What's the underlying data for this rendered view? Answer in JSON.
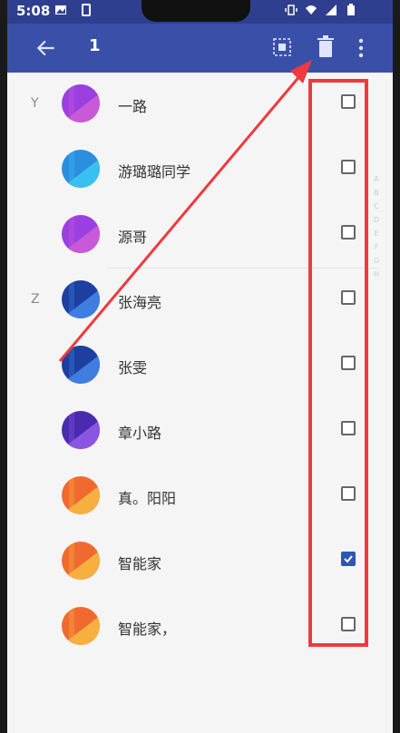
{
  "status_bar": {
    "time": "5:08"
  },
  "app_bar": {
    "selected_count": "1",
    "back_icon": "arrow-left-icon",
    "select_all_icon": "select-all-icon",
    "delete_icon": "trash-icon",
    "more_icon": "more-vert-icon"
  },
  "contacts": [
    {
      "section": "Y",
      "name": "一路",
      "avatar": "purple",
      "checked": false
    },
    {
      "section": "",
      "name": "游璐璐同学",
      "avatar": "blue",
      "checked": false
    },
    {
      "section": "",
      "name": "源哥",
      "avatar": "purple",
      "checked": false
    },
    {
      "section": "Z",
      "name": "张海亮",
      "avatar": "navy",
      "checked": false
    },
    {
      "section": "",
      "name": "张雯",
      "avatar": "navy",
      "checked": false
    },
    {
      "section": "",
      "name": "章小路",
      "avatar": "violet",
      "checked": false
    },
    {
      "section": "",
      "name": "真。阳阳",
      "avatar": "orange",
      "checked": false
    },
    {
      "section": "",
      "name": "智能家",
      "avatar": "orange",
      "checked": true
    },
    {
      "section": "",
      "name": "智能家，",
      "avatar": "orange",
      "checked": false
    }
  ],
  "colors": {
    "app_bar": "#3a4fa8",
    "status_bar": "#2f3f8f",
    "highlight": "#f0393e",
    "checkbox_checked": "#2e56b8"
  }
}
